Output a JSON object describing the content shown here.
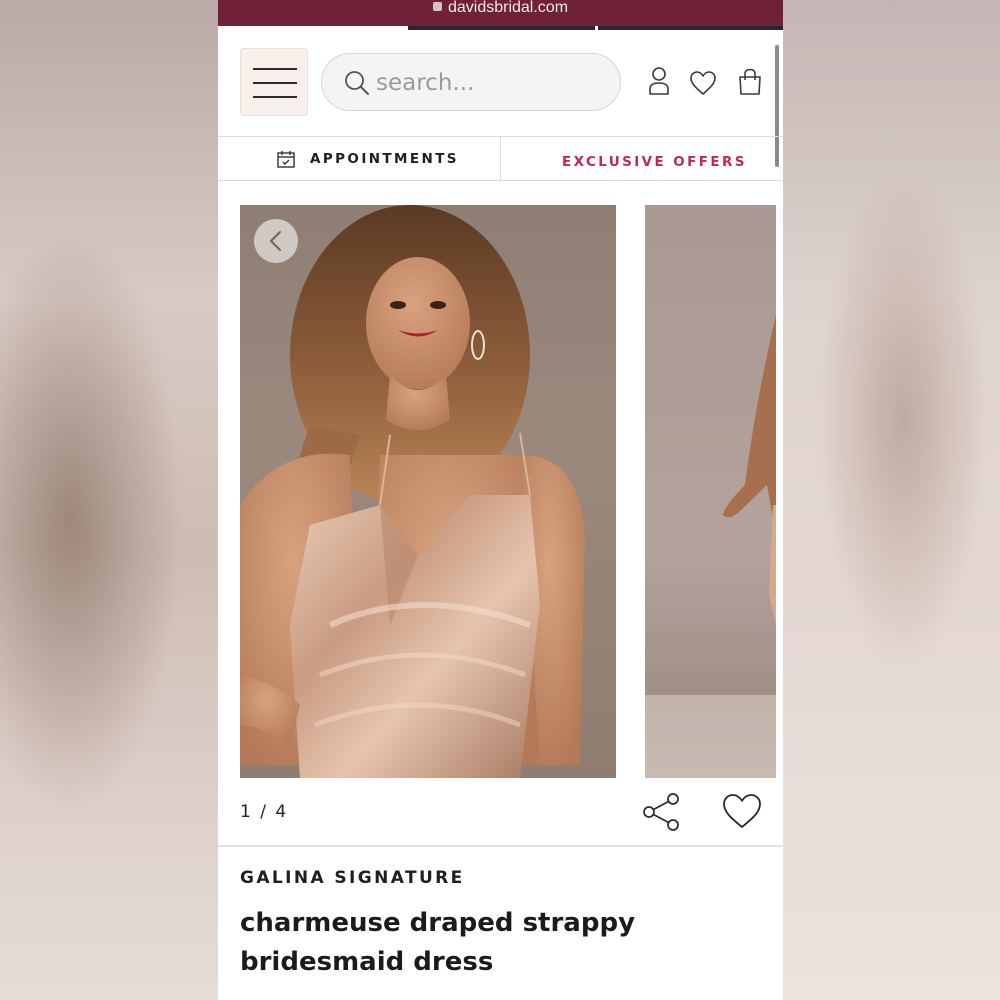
{
  "browser": {
    "url": "davidsbridal.com"
  },
  "header": {
    "search_placeholder": "search...",
    "menu_icon": "hamburger-icon",
    "account_icon": "user-icon",
    "wishlist_icon": "heart-icon",
    "bag_icon": "shopping-bag-icon"
  },
  "nav": {
    "appointments_label": "APPOINTMENTS",
    "offers_label": "EXCLUSIVE OFFERS"
  },
  "gallery": {
    "counter": "1 / 4",
    "current_index": 1,
    "total": 4
  },
  "product": {
    "brand": "GALINA SIGNATURE",
    "title": "charmeuse draped strappy bridesmaid dress"
  },
  "colors": {
    "url_bar": "#6f2138",
    "accent_offer": "#c0285a",
    "menu_bg": "#f7f0ea",
    "dress": "#d9b39a"
  }
}
